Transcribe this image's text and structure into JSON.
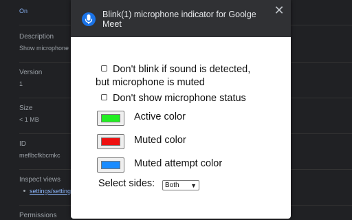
{
  "background": {
    "on_text": "On",
    "items": [
      {
        "label": "Description",
        "value": "Show microphone"
      },
      {
        "label": "Version",
        "value": "1"
      },
      {
        "label": "Size",
        "value": "< 1 MB"
      },
      {
        "label": "ID",
        "value": "meflbcfkbcmkc"
      },
      {
        "label": "Inspect views",
        "link": "settings/settings"
      },
      {
        "label": "Permissions"
      }
    ]
  },
  "popup": {
    "title": "Blink(1) microphone indicator for Goolge Meet",
    "close_icon": "close-icon",
    "options": {
      "dont_blink_line1": "Don't blink if sound is detected,",
      "dont_blink_line2": "but microphone is muted",
      "dont_show": "Don't show microphone status"
    },
    "colors": [
      {
        "label": "Active color",
        "value": "#22ee22"
      },
      {
        "label": "Muted color",
        "value": "#ee1111"
      },
      {
        "label": "Muted attempt color",
        "value": "#1a8cff"
      }
    ],
    "sides_label": "Select sides:",
    "sides_value": "Both"
  }
}
